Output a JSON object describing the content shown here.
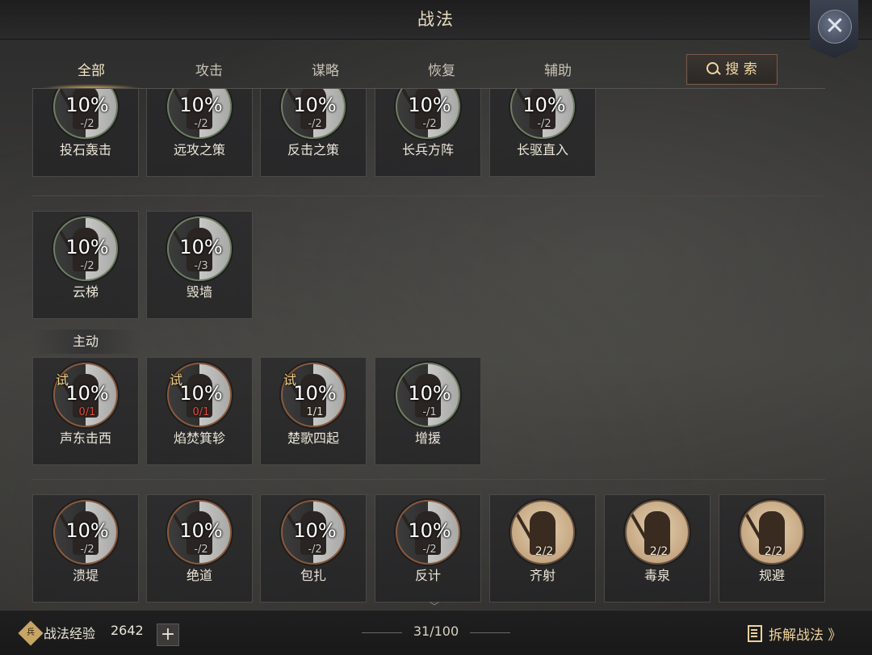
{
  "header": {
    "title": "战法",
    "close_icon": "crossed-swords-icon"
  },
  "tabs": [
    {
      "label": "全部",
      "active": true
    },
    {
      "label": "攻击"
    },
    {
      "label": "谋略"
    },
    {
      "label": "恢复"
    },
    {
      "label": "辅助"
    }
  ],
  "search": {
    "label": "搜 索"
  },
  "section_active_label": "主动",
  "row1": [
    {
      "name": "投石轰击",
      "pct": "10%",
      "count": "-/2"
    },
    {
      "name": "远攻之策",
      "pct": "10%",
      "count": "-/2"
    },
    {
      "name": "反击之策",
      "pct": "10%",
      "count": "-/2"
    },
    {
      "name": "长兵方阵",
      "pct": "10%",
      "count": "-/2"
    },
    {
      "name": "长驱直入",
      "pct": "10%",
      "count": "-/2"
    }
  ],
  "row2": [
    {
      "name": "云梯",
      "pct": "10%",
      "count": "-/2"
    },
    {
      "name": "毁墙",
      "pct": "10%",
      "count": "-/3"
    }
  ],
  "row3": [
    {
      "name": "声东击西",
      "pct": "10%",
      "count": "0/1",
      "trial": "试"
    },
    {
      "name": "焰焚箕轸",
      "pct": "10%",
      "count": "0/1",
      "trial": "试"
    },
    {
      "name": "楚歌四起",
      "pct": "10%",
      "count": "1/1",
      "trial": "试"
    },
    {
      "name": "增援",
      "pct": "10%",
      "count": "-/1"
    }
  ],
  "row4": [
    {
      "name": "溃堤",
      "pct": "10%",
      "count": "-/2"
    },
    {
      "name": "绝道",
      "pct": "10%",
      "count": "-/2"
    },
    {
      "name": "包扎",
      "pct": "10%",
      "count": "-/2"
    },
    {
      "name": "反计",
      "pct": "10%",
      "count": "-/2"
    },
    {
      "name": "齐射",
      "count": "2/2"
    },
    {
      "name": "毒泉",
      "count": "2/2"
    },
    {
      "name": "规避",
      "count": "2/2"
    }
  ],
  "footer": {
    "exp_icon_text": "兵",
    "exp_label": "战法经验",
    "exp_value": "2642",
    "plus": "+",
    "count": "31/100",
    "disassemble": "拆解战法 》"
  }
}
